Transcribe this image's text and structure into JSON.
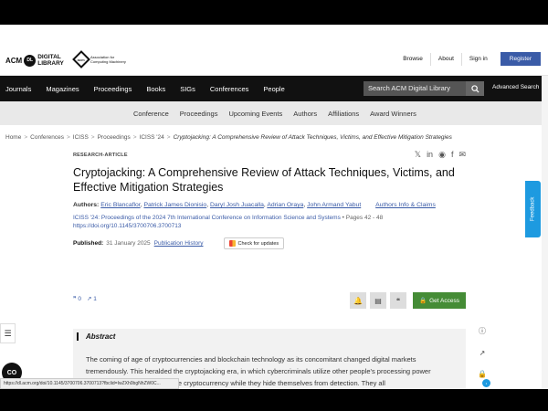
{
  "header": {
    "acm_logo_text": "ACM",
    "acm_logo_ring": "DL",
    "dl_line1": "DIGITAL",
    "dl_line2": "LIBRARY",
    "assoc_mark": "acm",
    "assoc_line1": "Association for",
    "assoc_line2": "Computing Machinery",
    "links": [
      "Browse",
      "About",
      "Sign in"
    ],
    "register_label": "Register"
  },
  "main_nav": {
    "items": [
      "Journals",
      "Magazines",
      "Proceedings",
      "Books",
      "SIGs",
      "Conferences",
      "People"
    ],
    "search_placeholder": "Search ACM Digital Library",
    "advanced_search": "Advanced Search"
  },
  "sub_nav": {
    "items": [
      "Conference",
      "Proceedings",
      "Upcoming Events",
      "Authors",
      "Affiliations",
      "Award Winners"
    ]
  },
  "breadcrumb": {
    "items": [
      "Home",
      "Conferences",
      "ICISS",
      "Proceedings",
      "ICISS '24"
    ],
    "current": "Cryptojacking: A Comprehensive Review of Attack Techniques, Victims, and Effective Mitigation Strategies"
  },
  "article": {
    "type": "RESEARCH-ARTICLE",
    "title": "Cryptojacking: A Comprehensive Review of Attack Techniques, Victims, and Effective Mitigation Strategies",
    "authors_label": "Authors:",
    "authors": [
      "Eric Blancaflor",
      "Patrick James Dionisio",
      "Daryl Josh Juacalla",
      "Adrian Oraya",
      "John Armand Yabut"
    ],
    "authors_info": "Authors Info & Claims",
    "proceedings": "ICISS '24: Proceedings of the 2024 7th International Conference on Information Science and Systems",
    "pages": "• Pages 42 - 48",
    "doi": "https://doi.org/10.1145/3700706.3700713",
    "published_label": "Published:",
    "published_date": "31 January 2025",
    "publication_history": "Publication History",
    "check_updates": "Check for updates"
  },
  "metrics": {
    "citations": "0",
    "downloads": "1"
  },
  "actions": {
    "get_access": "Get Access"
  },
  "abstract": {
    "heading": "Abstract",
    "line1": "The coming of age of cryptocurrencies and blockchain technology as its concomitant changed digital markets",
    "line2": "tremendously. This heralded the cryptojacking era, in which cybercriminals utilize other people's processing power",
    "line3": "without their knowledge to mine cryptocurrency while they hide themselves from detection. They all"
  },
  "feedback_label": "Feedback",
  "cc_label": "CO",
  "status_url": "https://dl.acm.org/doi/10.1145/3700706.3700713?fbclid=IwZXh0bgNhZW0C..."
}
